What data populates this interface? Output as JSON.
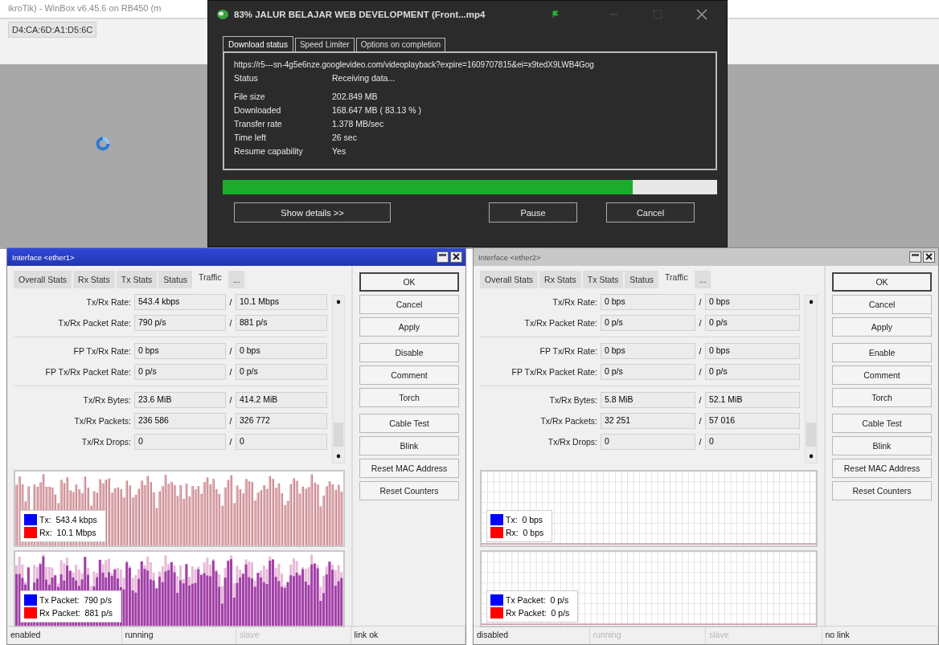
{
  "background": {
    "title": "ikroTik) - WinBox v6.45.6 on RB450 (m",
    "mac_field": "D4:CA:6D:A1:D5:6C"
  },
  "download": {
    "title": "83% JALUR BELAJAR WEB DEVELOPMENT (Front...mp4",
    "tabs": [
      {
        "label": "Download status",
        "selected": true
      },
      {
        "label": "Speed Limiter",
        "selected": false
      },
      {
        "label": "Options on completion",
        "selected": false
      }
    ],
    "url": "https://r5---sn-4g5e6nze.googlevideo.com/videoplayback?expire=1609707815&ei=x9tedX9LWB4Gog",
    "status": {
      "label": "Status",
      "value": "Receiving data..."
    },
    "info": [
      {
        "label": "File size",
        "value": "202.849 MB"
      },
      {
        "label": "Downloaded",
        "value": "168.647 MB ( 83.13 % )"
      },
      {
        "label": "Transfer rate",
        "value": "1.378 MB/sec"
      },
      {
        "label": "Time left",
        "value": "26 sec"
      },
      {
        "label": "Resume capability",
        "value": "Yes"
      }
    ],
    "level": 0.83,
    "buttons": [
      "Show details >>",
      "Pause",
      "Cancel"
    ]
  },
  "windows": [
    {
      "title": "Interface <ether1>",
      "active": true,
      "tabs": [
        {
          "label": "Overall Stats",
          "selected": false
        },
        {
          "label": "Rx Stats",
          "selected": false
        },
        {
          "label": "Tx Stats",
          "selected": false
        },
        {
          "label": "Status",
          "selected": false
        },
        {
          "label": "Traffic",
          "selected": true
        },
        {
          "label": "...",
          "selected": false
        }
      ],
      "field_groups": [
        [
          {
            "label": "Tx/Rx Rate:",
            "tx": "543.4 kbps",
            "sep": "/",
            "rx": "10.1 Mbps"
          },
          {
            "label": "Tx/Rx Packet Rate:",
            "tx": "790 p/s",
            "sep": "/",
            "rx": "881 p/s"
          }
        ],
        [
          {
            "label": "FP Tx/Rx Rate:",
            "tx": "0 bps",
            "sep": "/",
            "rx": "0 bps"
          },
          {
            "label": "FP Tx/Rx Packet Rate:",
            "tx": "0 p/s",
            "sep": "/",
            "rx": "0 p/s"
          }
        ],
        [
          {
            "label": "Tx/Rx Bytes:",
            "tx": "23.6 MiB",
            "sep": "/",
            "rx": "414.2 MiB"
          },
          {
            "label": "Tx/Rx Packets:",
            "tx": "236 586",
            "sep": "/",
            "rx": "326 772"
          },
          {
            "label": "Tx/Rx Drops:",
            "tx": "0",
            "sep": "/",
            "rx": "0"
          }
        ]
      ],
      "button_groups": [
        [
          "OK",
          "Cancel",
          "Apply"
        ],
        [
          "Disable",
          "Comment",
          "Torch"
        ],
        [
          "Cable Test",
          "Blink",
          "Reset MAC Address",
          "Reset Counters"
        ]
      ],
      "graphs": [
        {
          "kind": "bytes",
          "legend": [
            {
              "label": "Tx:  543.4 kbps",
              "color": "#0000ff"
            },
            {
              "label": "Rx:  10.1 Mbps",
              "color": "#ff0000"
            }
          ]
        },
        {
          "kind": "packets",
          "legend": [
            {
              "label": "Tx Packet:  790 p/s",
              "color": "#0000ff"
            },
            {
              "label": "Rx Packet:  881 p/s",
              "color": "#ff0000"
            }
          ]
        }
      ],
      "status_bar": [
        {
          "text": "enabled",
          "disabled": false
        },
        {
          "text": "running",
          "disabled": false
        },
        {
          "text": "slave",
          "disabled": true
        },
        {
          "text": "link ok",
          "disabled": false
        }
      ]
    },
    {
      "title": "Interface <ether2>",
      "active": false,
      "tabs": [
        {
          "label": "Overall Stats",
          "selected": false
        },
        {
          "label": "Rx Stats",
          "selected": false
        },
        {
          "label": "Tx Stats",
          "selected": false
        },
        {
          "label": "Status",
          "selected": false
        },
        {
          "label": "Traffic",
          "selected": true
        },
        {
          "label": "...",
          "selected": false
        }
      ],
      "field_groups": [
        [
          {
            "label": "Tx/Rx Rate:",
            "tx": "0 bps",
            "sep": "/",
            "rx": "0 bps"
          },
          {
            "label": "Tx/Rx Packet Rate:",
            "tx": "0 p/s",
            "sep": "/",
            "rx": "0 p/s"
          }
        ],
        [
          {
            "label": "FP Tx/Rx Rate:",
            "tx": "0 bps",
            "sep": "/",
            "rx": "0 bps"
          },
          {
            "label": "FP Tx/Rx Packet Rate:",
            "tx": "0 p/s",
            "sep": "/",
            "rx": "0 p/s"
          }
        ],
        [
          {
            "label": "Tx/Rx Bytes:",
            "tx": "5.8 MiB",
            "sep": "/",
            "rx": "52.1 MiB"
          },
          {
            "label": "Tx/Rx Packets:",
            "tx": "32 251",
            "sep": "/",
            "rx": "57 016"
          },
          {
            "label": "Tx/Rx Drops:",
            "tx": "0",
            "sep": "/",
            "rx": "0"
          }
        ]
      ],
      "button_groups": [
        [
          "OK",
          "Cancel",
          "Apply"
        ],
        [
          "Enable",
          "Comment",
          "Torch"
        ],
        [
          "Cable Test",
          "Blink",
          "Reset MAC Address",
          "Reset Counters"
        ]
      ],
      "graphs": [
        {
          "kind": "idle",
          "legend": [
            {
              "label": "Tx:  0 bps",
              "color": "#0000ff"
            },
            {
              "label": "Rx:  0 bps",
              "color": "#ff0000"
            }
          ]
        },
        {
          "kind": "idle",
          "legend": [
            {
              "label": "Tx Packet:  0 p/s",
              "color": "#0000ff"
            },
            {
              "label": "Rx Packet:  0 p/s",
              "color": "#ff0000"
            }
          ]
        }
      ],
      "status_bar": [
        {
          "text": "disabled",
          "disabled": false
        },
        {
          "text": "running",
          "disabled": true
        },
        {
          "text": "slave",
          "disabled": true
        },
        {
          "text": "no link",
          "disabled": false
        }
      ]
    }
  ]
}
